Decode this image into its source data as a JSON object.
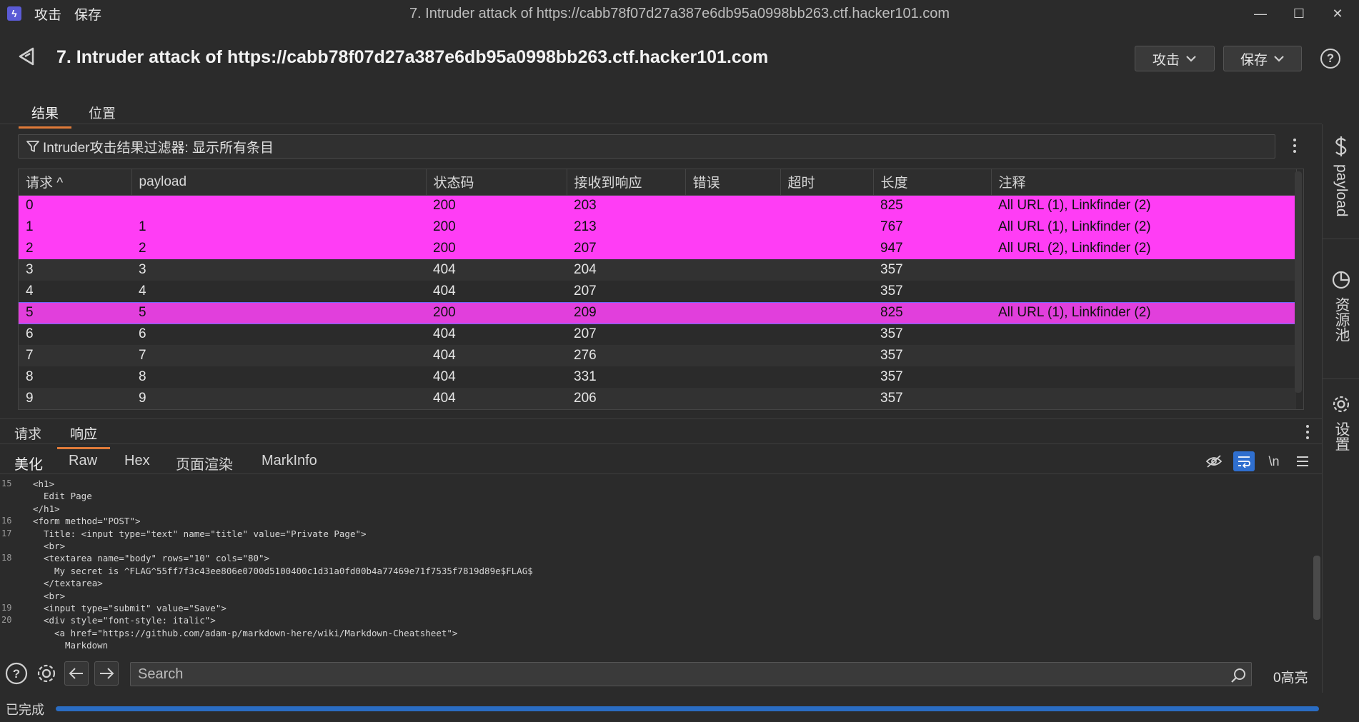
{
  "app": {
    "menu": [
      "攻击",
      "保存"
    ],
    "window_title": "7. Intruder attack of https://cabb78f07d27a387e6db95a0998bb263.ctf.hacker101.com"
  },
  "header": {
    "title": "7. Intruder attack of https://cabb78f07d27a387e6db95a0998bb263.ctf.hacker101.com",
    "attack_button": "攻击",
    "save_button": "保存"
  },
  "main_tabs": [
    "结果",
    "位置"
  ],
  "filter": {
    "label": "Intruder攻击结果过滤器: 显示所有条目"
  },
  "table": {
    "columns": [
      "请求 ^",
      "payload",
      "状态码",
      "接收到响应",
      "错误",
      "超时",
      "长度",
      "注释"
    ],
    "rows": [
      {
        "req": "0",
        "payload": "",
        "status": "200",
        "received": "203",
        "error": "",
        "timeout": "",
        "length": "825",
        "comment": "All URL (1), Linkfinder (2)",
        "style": "hl"
      },
      {
        "req": "1",
        "payload": "1",
        "status": "200",
        "received": "213",
        "error": "",
        "timeout": "",
        "length": "767",
        "comment": "All URL (1), Linkfinder (2)",
        "style": "hl"
      },
      {
        "req": "2",
        "payload": "2",
        "status": "200",
        "received": "207",
        "error": "",
        "timeout": "",
        "length": "947",
        "comment": "All URL (2), Linkfinder (2)",
        "style": "hl"
      },
      {
        "req": "3",
        "payload": "3",
        "status": "404",
        "received": "204",
        "error": "",
        "timeout": "",
        "length": "357",
        "comment": "",
        "style": "odd"
      },
      {
        "req": "4",
        "payload": "4",
        "status": "404",
        "received": "207",
        "error": "",
        "timeout": "",
        "length": "357",
        "comment": "",
        "style": "even"
      },
      {
        "req": "5",
        "payload": "5",
        "status": "200",
        "received": "209",
        "error": "",
        "timeout": "",
        "length": "825",
        "comment": "All URL (1), Linkfinder (2)",
        "style": "sel"
      },
      {
        "req": "6",
        "payload": "6",
        "status": "404",
        "received": "207",
        "error": "",
        "timeout": "",
        "length": "357",
        "comment": "",
        "style": "even"
      },
      {
        "req": "7",
        "payload": "7",
        "status": "404",
        "received": "276",
        "error": "",
        "timeout": "",
        "length": "357",
        "comment": "",
        "style": "odd"
      },
      {
        "req": "8",
        "payload": "8",
        "status": "404",
        "received": "331",
        "error": "",
        "timeout": "",
        "length": "357",
        "comment": "",
        "style": "even"
      },
      {
        "req": "9",
        "payload": "9",
        "status": "404",
        "received": "206",
        "error": "",
        "timeout": "",
        "length": "357",
        "comment": "",
        "style": "odd"
      }
    ]
  },
  "response_tabs": [
    "请求",
    "响应"
  ],
  "view_tabs": [
    "美化",
    "Raw",
    "Hex",
    "页面渲染",
    "MarkInfo"
  ],
  "view_newline_label": "\\n",
  "code_lines": [
    {
      "num": "15",
      "indent": 1,
      "text": "<h1>"
    },
    {
      "num": "",
      "indent": 2,
      "text": "Edit Page"
    },
    {
      "num": "",
      "indent": 1,
      "text": "</h1>"
    },
    {
      "num": "16",
      "indent": 1,
      "text": "<form method=\"POST\">"
    },
    {
      "num": "17",
      "indent": 2,
      "text": "Title: <input type=\"text\" name=\"title\" value=\"Private Page\">"
    },
    {
      "num": "",
      "indent": 2,
      "text": "<br>"
    },
    {
      "num": "18",
      "indent": 2,
      "text": "<textarea name=\"body\" rows=\"10\" cols=\"80\">"
    },
    {
      "num": "",
      "indent": 3,
      "text": "My secret is ^FLAG^55ff7f3c43ee806e0700d5100400c1d31a0fd00b4a77469e71f7535f7819d89e$FLAG$"
    },
    {
      "num": "",
      "indent": 2,
      "text": "</textarea>"
    },
    {
      "num": "",
      "indent": 2,
      "text": "<br>"
    },
    {
      "num": "19",
      "indent": 2,
      "text": "<input type=\"submit\" value=\"Save\">"
    },
    {
      "num": "20",
      "indent": 2,
      "text": "<div style=\"font-style: italic\">"
    },
    {
      "num": "",
      "indent": 3,
      "text": "<a href=\"https://github.com/adam-p/markdown-here/wiki/Markdown-Cheatsheet\">"
    },
    {
      "num": "",
      "indent": 4,
      "text": "Markdown"
    }
  ],
  "search": {
    "placeholder": "Search",
    "highlight_count": "0高亮"
  },
  "status": {
    "text": "已完成",
    "progress": 1.0
  },
  "right_sidebar": [
    "payload",
    "资源池",
    "设置"
  ],
  "colors": {
    "highlight_row": "#ff3df5",
    "selected_row": "#e13fdc",
    "accent_tab": "#e07b39",
    "progress": "#2a6dc4"
  }
}
